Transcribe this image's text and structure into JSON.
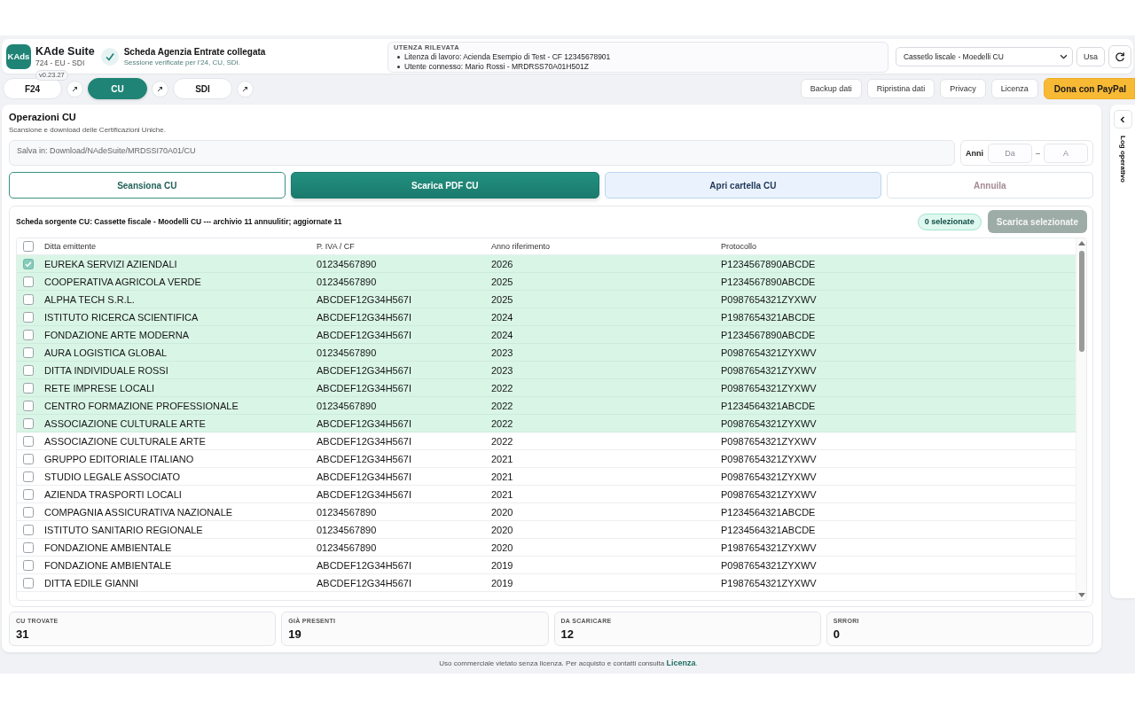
{
  "header": {
    "logo_text": "KAds",
    "app_name": "KAde Suite",
    "app_subtitle": "724 - EU - SDI",
    "version": "v0.23.27",
    "connection": {
      "connected": true,
      "title": "Scheda Agenzia Entrate collegata",
      "subtitle": "Sessione verificate per l'24, CU, SDI."
    },
    "user_info": {
      "title": "UTENZA RILEVATA",
      "items": [
        "Litenza di lavoro: Acienda Esempio di Test - CF 12345678901",
        "Utente connesso: Mario Rossi - MRDRSS70A01H501Z"
      ]
    },
    "source_select": {
      "value": "Cassetlo liscale - Moedelli CU"
    },
    "use_button": "Usa"
  },
  "tabs": [
    {
      "label": "F24",
      "selected": false
    },
    {
      "label": "CU",
      "selected": true
    },
    {
      "label": "SDI",
      "selected": false
    }
  ],
  "actions": [
    {
      "label": "Backup dati",
      "kind": "plain"
    },
    {
      "label": "Ripristina dati",
      "kind": "plain"
    },
    {
      "label": "Privacy",
      "kind": "plain"
    },
    {
      "label": "Licenza",
      "kind": "plain"
    },
    {
      "label": "Dona con PayPal",
      "kind": "donate"
    }
  ],
  "operations": {
    "title": "Operazioni CU",
    "subtitle": "Scansione e download delle Certificazioni Uniche.",
    "save_path": "Salva in: Download/NAdeSuite/MRDSSI70A01/CU",
    "years": {
      "label": "Anni",
      "from_placeholder": "Da",
      "separator": "–",
      "to_placeholder": "A"
    },
    "buttons": [
      {
        "label": "Seansiona CU",
        "kind": "outline"
      },
      {
        "label": "Scarica PDF CU",
        "kind": "primary"
      },
      {
        "label": "Apri cartella CU",
        "kind": "soft"
      },
      {
        "label": "Annuila",
        "kind": "cancel"
      }
    ]
  },
  "table": {
    "source_note": "Scheda sorgente CU: Cassette fiscale - Moodelli CU --- archivio 11 annuulitir; aggiornate 11",
    "selected_count": "0 selezionate",
    "download_selected": {
      "label": "Scarica selezionate",
      "disabled": true
    },
    "select_all_checked": false,
    "columns": [
      "Ditta emittente",
      "P. IVA / CF",
      "Anno riferimento",
      "Protocollo"
    ],
    "rows": [
      {
        "cells": [
          "EUREKA SERVIZI AZIENDALI",
          "01234567890",
          "2026",
          "P1234567890ABCDE"
        ],
        "checked": true,
        "highlighted": true
      },
      {
        "cells": [
          "COOPERATIVA AGRICOLA VERDE",
          "01234567890",
          "2025",
          "P1234567890ABCDE"
        ],
        "checked": false,
        "highlighted": true
      },
      {
        "cells": [
          "ALPHA TECH S.R.L.",
          "ABCDEF12G34H567I",
          "2025",
          "P0987654321ZYXWV"
        ],
        "checked": false,
        "highlighted": true
      },
      {
        "cells": [
          "ISTITUTO RICERCA SCIENTIFICA",
          "ABCDEF12G34H567I",
          "2024",
          "P1987654321ABCDE"
        ],
        "checked": false,
        "highlighted": true
      },
      {
        "cells": [
          "FONDAZIONE ARTE MODERNA",
          "ABCDEF12G34H567I",
          "2024",
          "P1234567890ABCDE"
        ],
        "checked": false,
        "highlighted": true
      },
      {
        "cells": [
          "AURA LOGISTICA GLOBAL",
          "01234567890",
          "2023",
          "P0987654321ZYXWV"
        ],
        "checked": false,
        "highlighted": true
      },
      {
        "cells": [
          "DITTA INDIVIDUALE ROSSI",
          "ABCDEF12G34H567I",
          "2023",
          "P0987654321ZYXWV"
        ],
        "checked": false,
        "highlighted": true
      },
      {
        "cells": [
          "RETE IMPRESE LOCALI",
          "ABCDEF12G34H567I",
          "2022",
          "P0987654321ZYXWV"
        ],
        "checked": false,
        "highlighted": true
      },
      {
        "cells": [
          "CENTRO FORMAZIONE PROFESSIONALE",
          "01234567890",
          "2022",
          "P1234564321ABCDE"
        ],
        "checked": false,
        "highlighted": true
      },
      {
        "cells": [
          "ASSOCIAZIONE CULTURALE ARTE",
          "ABCDEF12G34H567I",
          "2022",
          "P0987654321ZYXWV"
        ],
        "checked": false,
        "highlighted": true
      },
      {
        "cells": [
          "ASSOCIAZIONE CULTURALE ARTE",
          "ABCDEF12G34H567I",
          "2022",
          "P0987654321ZYXWV"
        ],
        "checked": false,
        "highlighted": false
      },
      {
        "cells": [
          "GRUPPO EDITORIALE ITALIANO",
          "ABCDEF12G34H567I",
          "2021",
          "P0987654321ZYXWV"
        ],
        "checked": false,
        "highlighted": false
      },
      {
        "cells": [
          "STUDIO LEGALE ASSOCIATO",
          "ABCDEF12G34H567I",
          "2021",
          "P0987654321ZYXWV"
        ],
        "checked": false,
        "highlighted": false
      },
      {
        "cells": [
          "AZIENDA TRASPORTI LOCALI",
          "ABCDEF12G34H567I",
          "2021",
          "P0987654321ZYXWV"
        ],
        "checked": false,
        "highlighted": false
      },
      {
        "cells": [
          "COMPAGNIA ASSICURATIVA NAZIONALE",
          "01234567890",
          "2020",
          "P1234564321ABCDE"
        ],
        "checked": false,
        "highlighted": false
      },
      {
        "cells": [
          "ISTITUTO SANITARIO REGIONALE",
          "01234567890",
          "2020",
          "P1234564321ABCDE"
        ],
        "checked": false,
        "highlighted": false
      },
      {
        "cells": [
          "FONDAZIONE AMBIENTALE",
          "01234567890",
          "2020",
          "P1987654321ZYXWV"
        ],
        "checked": false,
        "highlighted": false
      },
      {
        "cells": [
          "FONDAZIONE AMBIENTALE",
          "ABCDEF12G34H567I",
          "2019",
          "P0987654321ZYXWV"
        ],
        "checked": false,
        "highlighted": false
      },
      {
        "cells": [
          "DITTA EDILE GIANNI",
          "ABCDEF12G34H567I",
          "2019",
          "P1987654321ZYXWV"
        ],
        "checked": false,
        "highlighted": false
      }
    ]
  },
  "stats": [
    {
      "label": "CU TROVATE",
      "value": "31"
    },
    {
      "label": "GIÀ PRESENTI",
      "value": "19"
    },
    {
      "label": "DA SCARICARE",
      "value": "12"
    },
    {
      "label": "SRRORI",
      "value": "0"
    }
  ],
  "log_panel": {
    "title": "Log operativo",
    "expanded": false
  },
  "footer": {
    "text": "Uso commerciale vietato senza licenza. Per acquisto e contatti consulta",
    "link": "Licenza",
    "suffix": "."
  }
}
